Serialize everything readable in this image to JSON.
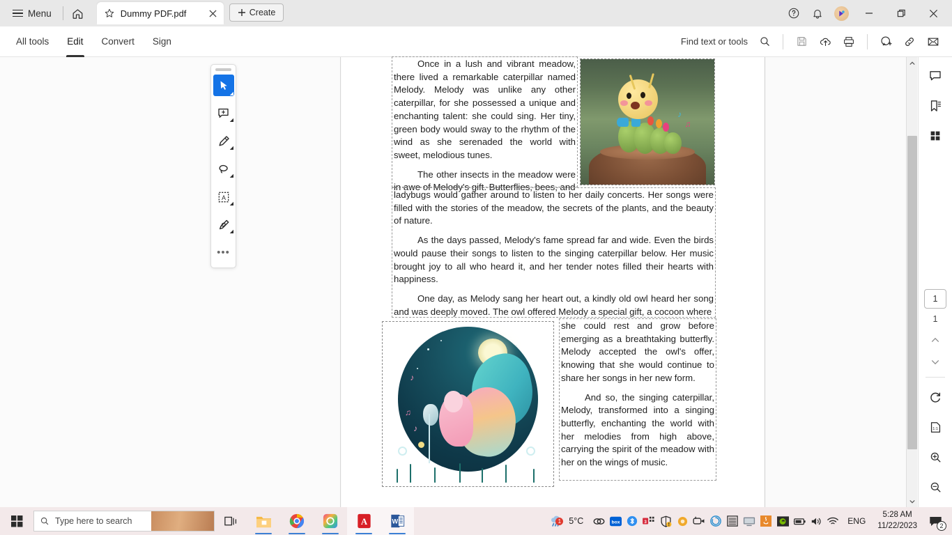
{
  "titlebar": {
    "menu_label": "Menu",
    "home_icon": "home-icon",
    "tab": {
      "title": "Dummy PDF.pdf",
      "star_icon": "star-icon",
      "close_icon": "close-icon"
    },
    "create_label": "Create",
    "help_icon": "help-circle-icon",
    "bell_icon": "bell-icon",
    "avatar": "user-avatar",
    "minimize_icon": "minimize-icon",
    "restore_icon": "restore-icon",
    "close_icon": "window-close-icon"
  },
  "toolbar": {
    "tabs": [
      {
        "label": "All tools",
        "active": false
      },
      {
        "label": "Edit",
        "active": true
      },
      {
        "label": "Convert",
        "active": false
      },
      {
        "label": "Sign",
        "active": false
      }
    ],
    "find_label": "Find text or tools",
    "icons": [
      "search-icon",
      "save-icon",
      "cloud-upload-icon",
      "print-icon",
      "add-comment-icon",
      "link-icon",
      "email-icon"
    ]
  },
  "palette": {
    "items": [
      {
        "name": "select-tool",
        "active": true
      },
      {
        "name": "add-comment-tool",
        "active": false
      },
      {
        "name": "highlight-tool",
        "active": false
      },
      {
        "name": "lasso-erase-tool",
        "active": false
      },
      {
        "name": "text-select-tool",
        "active": false,
        "glyph": "A"
      },
      {
        "name": "draw-signature-tool",
        "active": false
      }
    ],
    "more_label": "•••"
  },
  "document": {
    "blocks": [
      {
        "id": "block-1",
        "paragraphs": [
          "Once in a lush and vibrant meadow, there lived a remarkable caterpillar named Melody. Melody was unlike any other caterpillar, for she possessed a unique and enchanting talent: she could sing. Her tiny, green body would sway to the rhythm of the wind as she serenaded the world with sweet, melodious tunes.",
          "The other insects in the meadow were in awe of Melody's gift. Butterflies, bees, and"
        ]
      },
      {
        "id": "block-2",
        "paragraphs": [
          "ladybugs would gather around to listen to her daily concerts. Her songs were filled with the stories of the meadow, the secrets of the plants, and the beauty of nature.",
          "As the days passed, Melody's fame spread far and wide. Even the birds would pause their songs to listen to the singing caterpillar below. Her music brought joy to all who heard it, and her tender notes filled their hearts with happiness.",
          "One day, as Melody sang her heart out, a kindly old owl heard her song and was deeply moved. The owl offered Melody a special gift, a cocoon where"
        ]
      },
      {
        "id": "block-3",
        "paragraphs": [
          "she could rest and grow before emerging as a breathtaking butterfly. Melody accepted the owl's offer, knowing that she would continue to share her songs in her new form.",
          "And so, the singing caterpillar, Melody, transformed into a singing butterfly, enchanting the world with her melodies from high above, carrying the spirit of the meadow with her on the wings of music."
        ]
      }
    ],
    "images": [
      {
        "name": "caterpillar-image",
        "alt": "Singing caterpillar figurine on a tree stump"
      },
      {
        "name": "butterfly-image",
        "alt": "Illustrated butterfly singing into a microphone under the moon"
      }
    ]
  },
  "rail": {
    "icons": [
      "comment-icon",
      "bookmark-icon",
      "thumbnails-icon"
    ],
    "page_current": "1",
    "page_total": "1",
    "prev_icon": "chevron-up-icon",
    "next_icon": "chevron-down-icon",
    "rotate_icon": "rotate-icon",
    "fit-page_icon": "fit-page-icon",
    "zoom_in_icon": "zoom-in-icon",
    "zoom_out_icon": "zoom-out-icon"
  },
  "scrollbar": {
    "up_icon": "scroll-up-icon",
    "down_icon": "scroll-down-icon"
  },
  "taskbar": {
    "start_icon": "windows-start-icon",
    "search_placeholder": "Type here to search",
    "taskview_icon": "task-view-icon",
    "apps": [
      {
        "name": "file-explorer",
        "open": true
      },
      {
        "name": "google-chrome",
        "open": true
      },
      {
        "name": "creative-app",
        "open": true
      },
      {
        "name": "adobe-acrobat",
        "open": true,
        "active": true
      },
      {
        "name": "microsoft-word",
        "open": true,
        "active": true
      }
    ],
    "weather": {
      "temp": "5°C",
      "badge": "1"
    },
    "tray_icons": [
      "creative-cloud-icon",
      "box-icon",
      "bluetooth-icon",
      "calendar-3-icon",
      "security-warning-icon",
      "orange-circle-icon",
      "camera-icon",
      "acronis-icon",
      "list-icon",
      "display-icon",
      "java-icon",
      "nvidia-icon",
      "battery-icon",
      "volume-icon",
      "wifi-icon"
    ],
    "language": "ENG",
    "time": "5:28 AM",
    "date": "11/22/2023",
    "notification_badge": "2"
  },
  "colors": {
    "accent_blue": "#1473e6",
    "titlebar_bg": "#e8e8e8",
    "taskbar_bg": "#f3e9ea",
    "page_bg": "#ffffff"
  }
}
